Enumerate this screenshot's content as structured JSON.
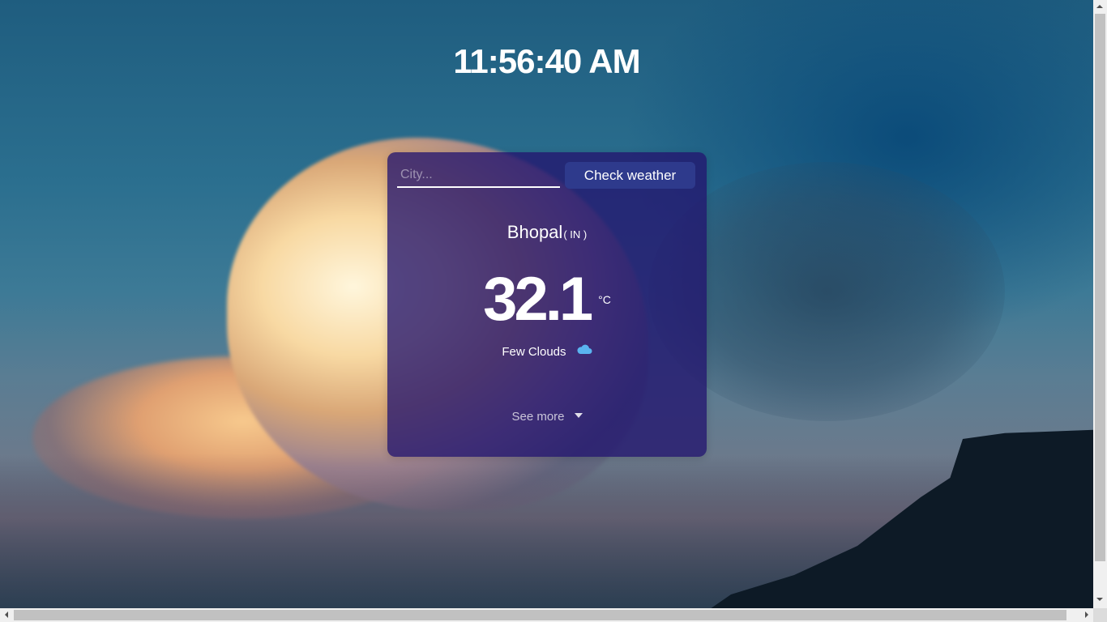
{
  "clock": {
    "time": "11:56:40 AM"
  },
  "search": {
    "placeholder": "City...",
    "value": "",
    "button_label": "Check weather"
  },
  "weather": {
    "city": "Bhopal",
    "country": "( IN )",
    "temperature": "32.1",
    "unit": "°C",
    "condition": "Few Clouds",
    "condition_icon": "cloud-icon",
    "see_more_label": "See more"
  },
  "colors": {
    "card_background": "#23146e",
    "button_background": "#2e3a8c",
    "cloud_icon": "#5ab4f0",
    "text": "#ffffff"
  }
}
